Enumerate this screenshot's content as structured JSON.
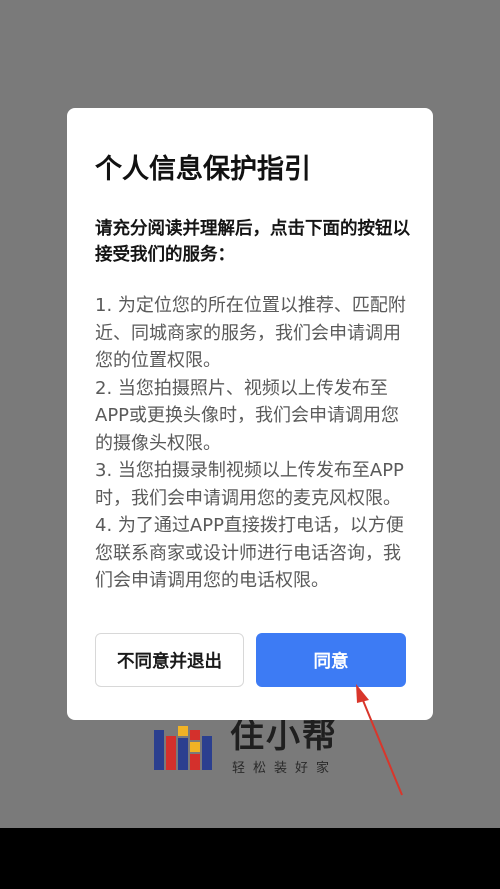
{
  "brand": {
    "name": "住小帮",
    "slogan": "轻松装好家"
  },
  "dialog": {
    "title": "个人信息保护指引",
    "lead": "请充分阅读并理解后，点击下面的按钮以接受我们的服务：",
    "paragraphs": [
      "1. 为定位您的所在位置以推荐、匹配附近、同城商家的服务，我们会申请调用您的位置权限。",
      "2. 当您拍摄照片、视频以上传发布至APP或更换头像时，我们会申请调用您的摄像头权限。",
      "3. 当您拍摄录制视频以上传发布至APP时，我们会申请调用您的麦克风权限。",
      "4. 为了通过APP直接拨打电话，以方便您联系商家或设计师进行电话咨询，我们会申请调用您的电话权限。"
    ],
    "decline_label": "不同意并退出",
    "agree_label": "同意"
  },
  "colors": {
    "overlay": "#7a7a7a",
    "primary": "#3d7bf4",
    "annotation_arrow": "#d9362b"
  },
  "icons": {
    "brand_mark": "zhuxiaobang-logo-icon",
    "annotation": "red-arrow-icon"
  }
}
